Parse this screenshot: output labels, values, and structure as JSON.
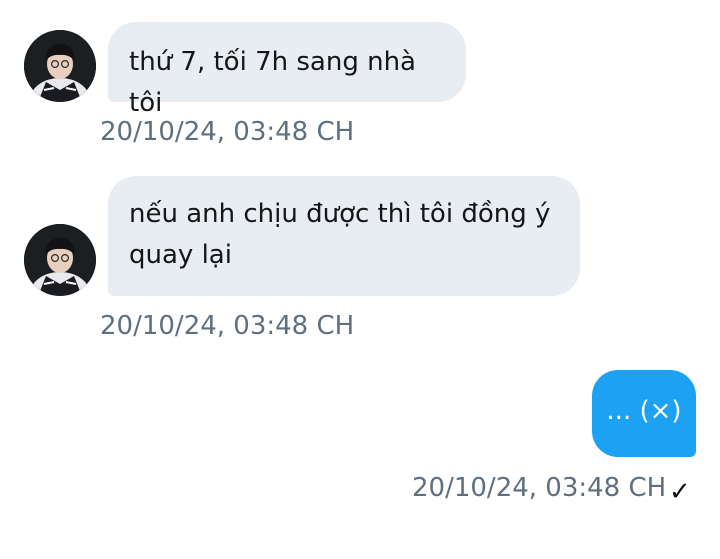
{
  "messages": [
    {
      "direction": "incoming",
      "text": "thứ 7, tối 7h sang nhà tôi",
      "timestamp": "20/10/24, 03:48 CH"
    },
    {
      "direction": "incoming",
      "text": "nếu anh chịu được thì tôi đồng ý quay lại",
      "timestamp": "20/10/24, 03:48 CH"
    },
    {
      "direction": "outgoing",
      "text": "... (×)",
      "timestamp": "20/10/24, 03:48 CH",
      "status_icon": "checkmark-icon",
      "status_glyph": "✓"
    }
  ],
  "colors": {
    "incoming_bubble": "#e8edf1",
    "outgoing_bubble": "#1da1f2",
    "timestamp_text": "#5f6f80"
  },
  "icons": {
    "avatar": "user-avatar-photo"
  }
}
